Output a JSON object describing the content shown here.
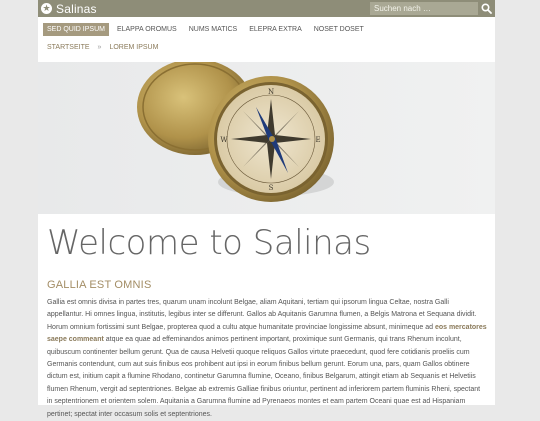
{
  "header": {
    "site_title": "Salinas",
    "logo_icon": "star-circle-icon",
    "search_placeholder": "Suchen nach …",
    "search_icon": "search-icon"
  },
  "nav": {
    "items": [
      {
        "label": "Sed quid ipsum",
        "active": true
      },
      {
        "label": "Elappa oromus",
        "active": false
      },
      {
        "label": "Nums matics",
        "active": false
      },
      {
        "label": "Elepra extra",
        "active": false
      },
      {
        "label": "Noset doset",
        "active": false
      }
    ]
  },
  "breadcrumb": {
    "home": "Startseite",
    "separator": "»",
    "current": "Lorem ipsum"
  },
  "content": {
    "heading": "Welcome to Salinas",
    "subheading": "GALLIA EST OMNIS",
    "para_part1": "Gallia est omnis divisa in partes tres, quarum unam incolunt Belgae, aliam Aquitani, tertiam qui ipsorum lingua Celtae, nostra Galli appellantur. Hi omnes lingua, institutis, legibus inter se differunt. Gallos ab Aquitanis Garumna flumen, a Belgis Matrona et Sequana dividit. Horum omnium fortissimi sunt Belgae, propterea quod a cultu atque humanitate provinciae longissime absunt, minimeque ad ",
    "para_highlight": "eos mercatores saepe commeant",
    "para_part2": " atque ea quae ad effeminandos animos pertinent important, proximique sunt Germanis, qui trans Rhenum incolunt, quibuscum continenter bellum gerunt. Qua de causa Helvetii quoque reliquos Gallos virtute praecedunt, quod fere cotidianis proeliis cum Germanis contendunt, cum aut suis finibus eos prohibent aut ipsi in eorum finibus bellum gerunt. Eorum una, pars, quam Gallos obtinere dictum est, initium capit a flumine Rhodano, continetur Garumna flumine, Oceano, finibus Belgarum, attingit etiam ab Sequanis et Helvetiis flumen Rhenum, vergit ad septentriones. Belgae ab extremis Galliae finibus oriuntur, pertinent ad inferiorem partem fluminis Rheni, spectant in septentrionem et orientem solem. Aquitania a Garumna flumine ad Pyrenaeos montes et eam partem Oceani quae est ad Hispaniam pertinet; spectat inter occasum solis et septentriones."
  },
  "colors": {
    "topbar": "#8e8d78",
    "accent": "#a59a7f",
    "heading": "#666666",
    "subheading": "#a38d65"
  }
}
